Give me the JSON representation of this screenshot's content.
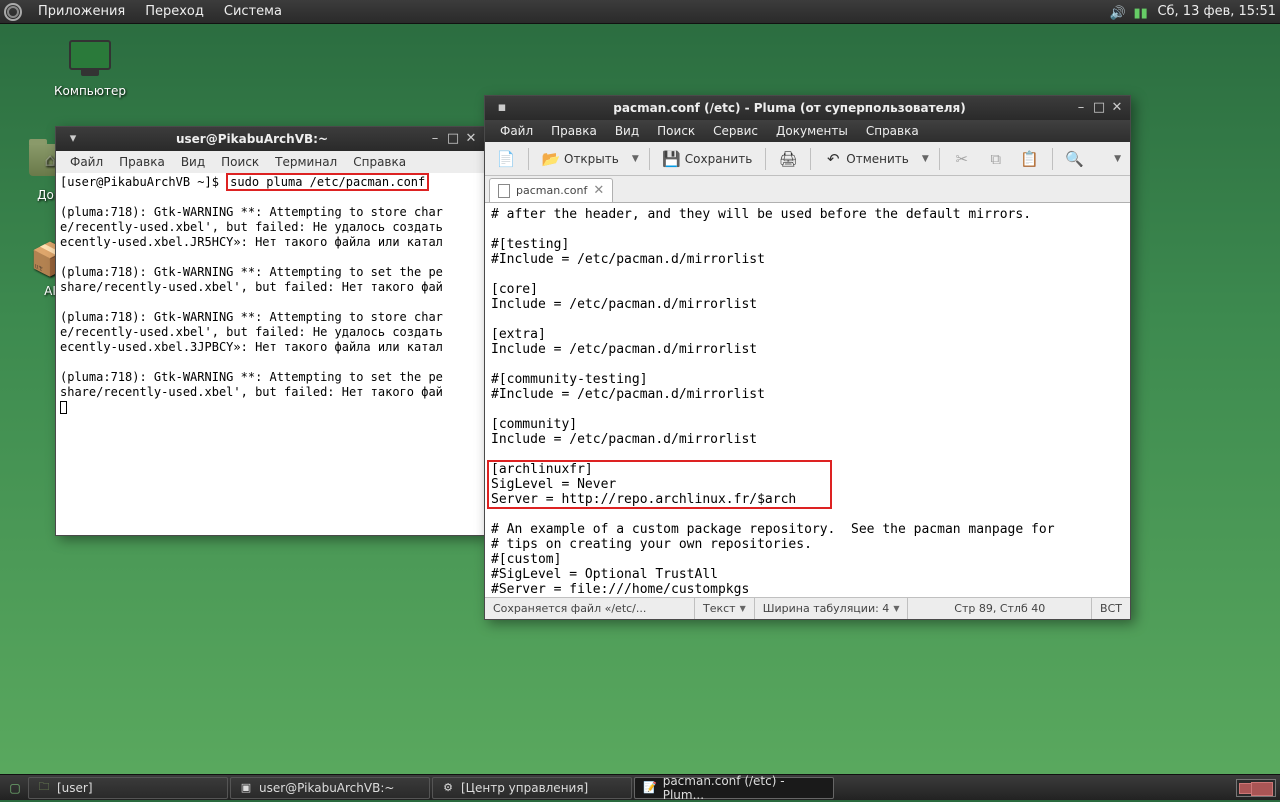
{
  "topbar": {
    "apps": "Приложения",
    "places": "Переход",
    "system": "Система",
    "clock": "Сб, 13 фев, 15:51"
  },
  "desktop": {
    "computer": "Компьютер",
    "home": "Дом"
  },
  "terminal": {
    "title": "user@PikabuArchVB:~",
    "menu": {
      "file": "Файл",
      "edit": "Правка",
      "view": "Вид",
      "search": "Поиск",
      "terminal": "Терминал",
      "help": "Справка"
    },
    "prompt": "[user@PikabuArchVB ~]$ ",
    "cmd": "sudo pluma /etc/pacman.conf",
    "out1": "(pluma:718): Gtk-WARNING **: Attempting to store char\ne/recently-used.xbel', but failed: Не удалось создать\necently-used.xbel.JR5HCY»: Нет такого файла или катал",
    "out2": "(pluma:718): Gtk-WARNING **: Attempting to set the pe\nshare/recently-used.xbel', but failed: Нет такого фай",
    "out3": "(pluma:718): Gtk-WARNING **: Attempting to store char\ne/recently-used.xbel', but failed: Не удалось создать\necently-used.xbel.3JPBCY»: Нет такого файла или катал",
    "out4": "(pluma:718): Gtk-WARNING **: Attempting to set the pe\nshare/recently-used.xbel', but failed: Нет такого фай"
  },
  "pluma": {
    "title": "pacman.conf (/etc) - Pluma (от суперпользователя)",
    "menu": {
      "file": "Файл",
      "edit": "Правка",
      "view": "Вид",
      "search": "Поиск",
      "tools": "Сервис",
      "documents": "Документы",
      "help": "Справка"
    },
    "toolbar": {
      "open": "Открыть",
      "save": "Сохранить",
      "undo": "Отменить"
    },
    "tab": "pacman.conf",
    "content_top": "# after the header, and they will be used before the default mirrors.\n\n#[testing]\n#Include = /etc/pacman.d/mirrorlist\n\n[core]\nInclude = /etc/pacman.d/mirrorlist\n\n[extra]\nInclude = /etc/pacman.d/mirrorlist\n\n#[community-testing]\n#Include = /etc/pacman.d/mirrorlist\n\n[community]\nInclude = /etc/pacman.d/mirrorlist\n",
    "content_hl": "[archlinuxfr]\nSigLevel = Never\nServer = http://repo.archlinux.fr/$arch",
    "content_bot": "\n# An example of a custom package repository.  See the pacman manpage for\n# tips on creating your own repositories.\n#[custom]\n#SigLevel = Optional TrustAll\n#Server = file:///home/custompkgs",
    "status": {
      "saving": "Сохраняется файл «/etc/...",
      "mode": "Текст",
      "tabwidth": "Ширина табуляции: 4",
      "cursor": "Стр 89, Стлб 40",
      "ins": "ВСТ"
    }
  },
  "taskbar": {
    "user": "[user]",
    "term": "user@PikabuArchVB:~",
    "control": "[Центр управления]",
    "pluma": "pacman.conf (/etc) - Plum..."
  }
}
